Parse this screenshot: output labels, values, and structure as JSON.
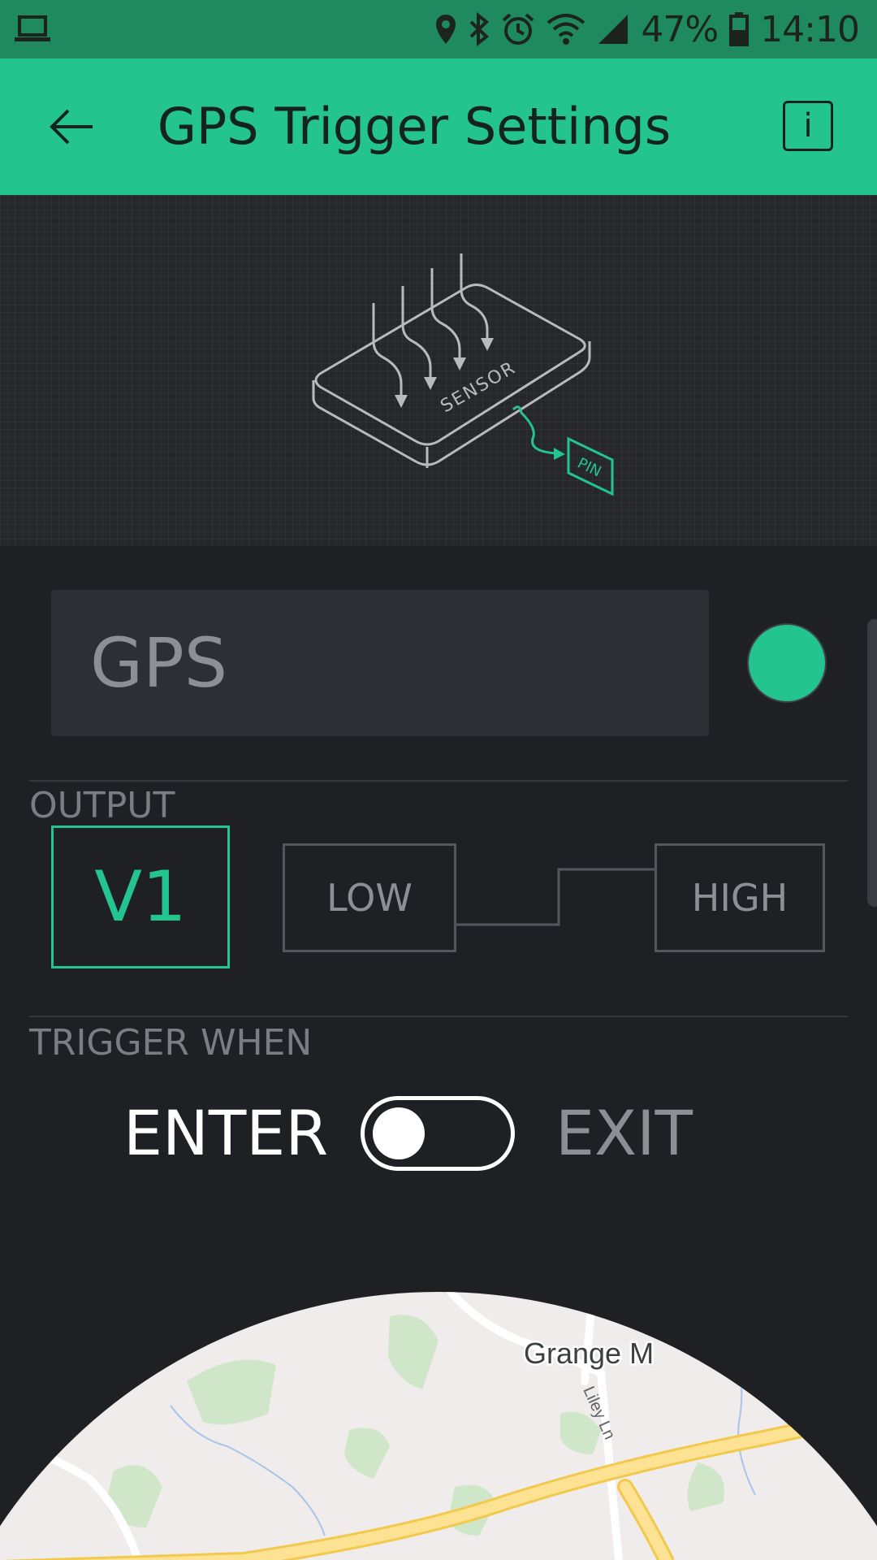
{
  "status_bar": {
    "battery": "47%",
    "time": "14:10"
  },
  "app_bar": {
    "title": "GPS Trigger Settings",
    "info_label": "i"
  },
  "illustration": {
    "sensor_label": "SENSOR",
    "pin_label": "PIN"
  },
  "widget": {
    "name": "GPS",
    "color": "#23c48e"
  },
  "output": {
    "section_label": "OUTPUT",
    "pin": "V1",
    "low_label": "LOW",
    "high_label": "HIGH"
  },
  "trigger": {
    "section_label": "TRIGGER WHEN",
    "enter_label": "ENTER",
    "exit_label": "EXIT",
    "selected": "ENTER"
  },
  "map": {
    "place_label": "Grange M",
    "road_label": "Liley Ln"
  },
  "colors": {
    "accent": "#23c48e",
    "background": "#1f2024",
    "status_bar": "#1f8a60"
  }
}
